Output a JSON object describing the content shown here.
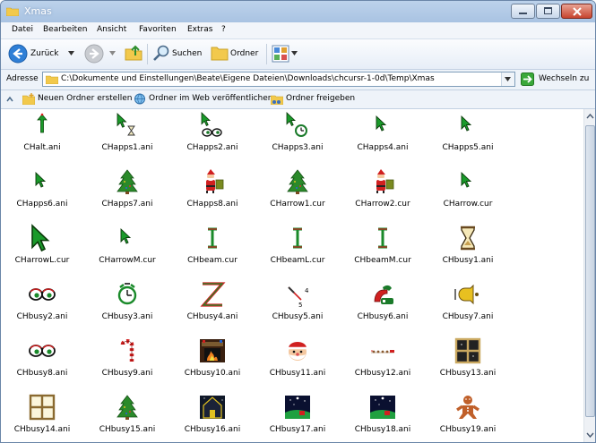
{
  "window": {
    "title": "Xmas"
  },
  "menu": [
    "Datei",
    "Bearbeiten",
    "Ansicht",
    "Favoriten",
    "Extras",
    "?"
  ],
  "toolbar": {
    "back_label": "Zurück",
    "search_label": "Suchen",
    "folders_label": "Ordner"
  },
  "address": {
    "label": "Adresse",
    "path": "C:\\Dokumente und Einstellungen\\Beate\\Eigene Dateien\\Downloads\\chcursr-1-0d\\Temp\\Xmas",
    "go_label": "Wechseln zu"
  },
  "tasks": [
    "Neuen Ordner erstellen",
    "Ordner im Web veröffentlichen",
    "Ordner freigeben"
  ],
  "files": [
    {
      "name": "CHalt.ani",
      "icon": "up-arrow-cursor-icon"
    },
    {
      "name": "CHapps1.ani",
      "icon": "arrow-hourglass-cursor-icon"
    },
    {
      "name": "CHapps2.ani",
      "icon": "arrow-eyes-cursor-icon"
    },
    {
      "name": "CHapps3.ani",
      "icon": "arrow-clock-cursor-icon"
    },
    {
      "name": "CHapps4.ani",
      "icon": "green-arrow-cursor-icon"
    },
    {
      "name": "CHapps5.ani",
      "icon": "green-arrow-cursor-icon"
    },
    {
      "name": "CHapps6.ani",
      "icon": "green-arrow-cursor-icon"
    },
    {
      "name": "CHapps7.ani",
      "icon": "christmas-tree-icon"
    },
    {
      "name": "CHapps8.ani",
      "icon": "santa-claus-icon"
    },
    {
      "name": "CHarrow1.cur",
      "icon": "christmas-tree-icon"
    },
    {
      "name": "CHarrow2.cur",
      "icon": "santa-claus-icon"
    },
    {
      "name": "CHarrow.cur",
      "icon": "green-arrow-cursor-icon"
    },
    {
      "name": "CHarrowL.cur",
      "icon": "large-green-arrow-icon"
    },
    {
      "name": "CHarrowM.cur",
      "icon": "green-arrow-cursor-icon"
    },
    {
      "name": "CHbeam.cur",
      "icon": "text-beam-cursor-icon"
    },
    {
      "name": "CHbeamL.cur",
      "icon": "text-beam-cursor-icon"
    },
    {
      "name": "CHbeamM.cur",
      "icon": "text-beam-cursor-icon"
    },
    {
      "name": "CHbusy1.ani",
      "icon": "hourglass-icon"
    },
    {
      "name": "CHbusy2.ani",
      "icon": "eyes-icon"
    },
    {
      "name": "CHbusy3.ani",
      "icon": "alarm-clock-icon"
    },
    {
      "name": "CHbusy4.ani",
      "icon": "zigzag-icon"
    },
    {
      "name": "CHbusy5.ani",
      "icon": "clock-hands-icon"
    },
    {
      "name": "CHbusy6.ani",
      "icon": "telephone-icon"
    },
    {
      "name": "CHbusy7.ani",
      "icon": "bell-icon"
    },
    {
      "name": "CHbusy8.ani",
      "icon": "eyes-icon"
    },
    {
      "name": "CHbusy9.ani",
      "icon": "candy-cane-icon"
    },
    {
      "name": "CHbusy10.ani",
      "icon": "fireplace-icon"
    },
    {
      "name": "CHbusy11.ani",
      "icon": "santa-face-icon"
    },
    {
      "name": "CHbusy12.ani",
      "icon": "reindeer-sleigh-icon"
    },
    {
      "name": "CHbusy13.ani",
      "icon": "window-dark-icon"
    },
    {
      "name": "CHbusy14.ani",
      "icon": "window-light-icon"
    },
    {
      "name": "CHbusy15.ani",
      "icon": "christmas-tree-icon"
    },
    {
      "name": "CHbusy16.ani",
      "icon": "house-night-icon"
    },
    {
      "name": "CHbusy17.ani",
      "icon": "night-scene-icon"
    },
    {
      "name": "CHbusy18.ani",
      "icon": "night-scene-icon"
    },
    {
      "name": "CHbusy19.ani",
      "icon": "gingerbread-man-icon"
    }
  ]
}
